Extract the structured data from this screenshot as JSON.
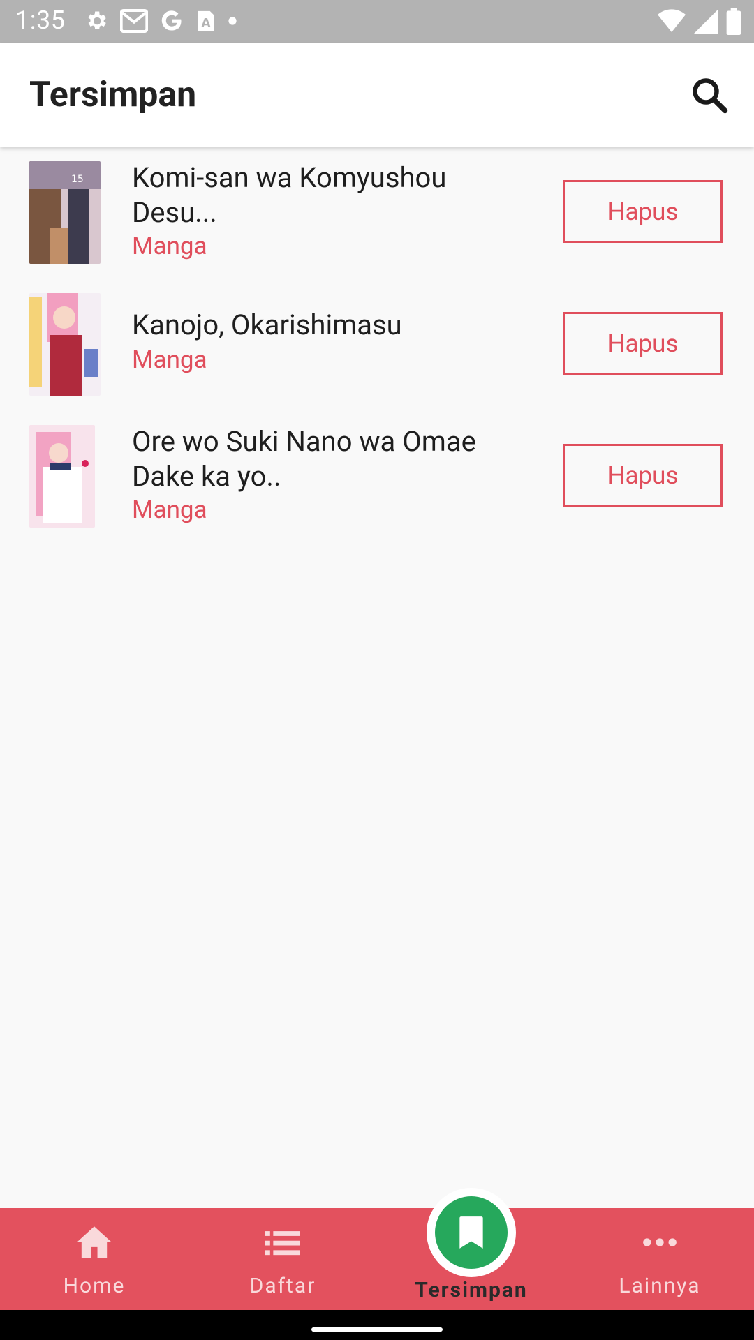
{
  "status_bar": {
    "time": "1:35",
    "left_icons": [
      "settings-icon",
      "gmail-icon",
      "google-icon",
      "a-icon",
      "dot-icon"
    ],
    "right_icons": [
      "wifi-icon",
      "signal-icon",
      "battery-icon"
    ]
  },
  "app_bar": {
    "title": "Tersimpan",
    "search_icon": "search-icon"
  },
  "items": [
    {
      "title": "Komi-san wa Komyushou Desu...",
      "category": "Manga",
      "action": "Hapus",
      "cover_colors": [
        "#7b5a3c",
        "#c9a8b8"
      ]
    },
    {
      "title": "Kanojo, Okarishimasu",
      "category": "Manga",
      "action": "Hapus",
      "cover_colors": [
        "#f4a3bf",
        "#e8e2f2"
      ]
    },
    {
      "title": " Ore wo Suki Nano wa Omae Dake ka yo..",
      "category": "Manga",
      "action": "Hapus",
      "cover_colors": [
        "#f5b6cc",
        "#f7eef3"
      ]
    }
  ],
  "bottom_nav": {
    "items": [
      {
        "label": "Home",
        "icon": "home-icon"
      },
      {
        "label": "Daftar",
        "icon": "list-icon"
      },
      {
        "label": "Tersimpan",
        "icon": "bookmark-icon",
        "active": true
      },
      {
        "label": "Lainnya",
        "icon": "more-icon"
      }
    ]
  },
  "colors": {
    "accent": "#e04e5c",
    "nav_bg": "#e3515e",
    "fab": "#26a85c",
    "status_bar": "#b3b3b3"
  }
}
